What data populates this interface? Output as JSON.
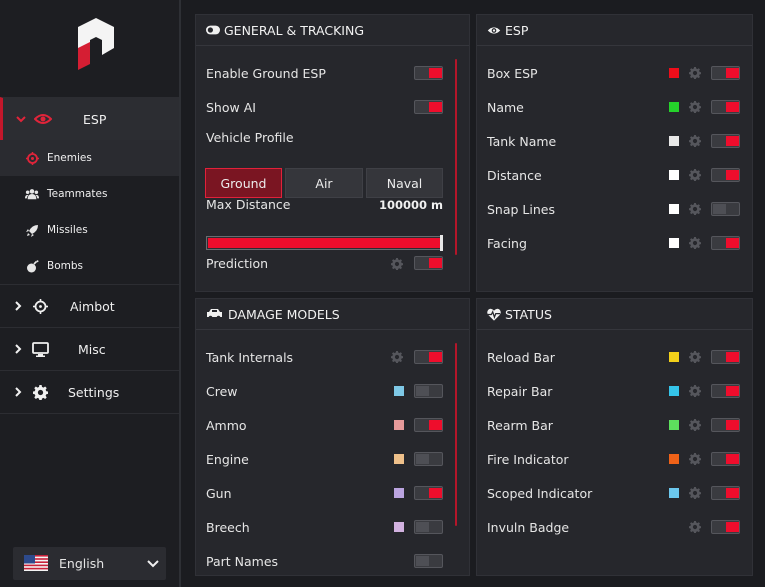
{
  "language": {
    "label": "English"
  },
  "sidebar": {
    "esp": {
      "label": "ESP",
      "subitems": [
        {
          "label": "Enemies"
        },
        {
          "label": "Teammates"
        },
        {
          "label": "Missiles"
        },
        {
          "label": "Bombs"
        }
      ]
    },
    "aimbot": {
      "label": "Aimbot"
    },
    "misc": {
      "label": "Misc"
    },
    "settings": {
      "label": "Settings"
    }
  },
  "general": {
    "title": "GENERAL & TRACKING",
    "enable_ground_esp": {
      "label": "Enable Ground ESP",
      "on": true
    },
    "show_ai": {
      "label": "Show AI",
      "on": true
    },
    "vehicle_profile": {
      "label": "Vehicle Profile",
      "options": [
        "Ground",
        "Air",
        "Naval"
      ],
      "selected": "Ground"
    },
    "max_distance": {
      "label": "Max Distance",
      "value_text": "100000 m",
      "fraction": 1.0
    },
    "prediction": {
      "label": "Prediction",
      "on": true
    }
  },
  "esp": {
    "title": "ESP",
    "rows": [
      {
        "label": "Box ESP",
        "color": "#ee0d1a",
        "on": true
      },
      {
        "label": "Name",
        "color": "#25d22b",
        "on": true
      },
      {
        "label": "Tank Name",
        "color": "#e8e8e8",
        "on": true
      },
      {
        "label": "Distance",
        "color": "#ffffff",
        "on": true
      },
      {
        "label": "Snap Lines",
        "color": "#ffffff",
        "on": false
      },
      {
        "label": "Facing",
        "color": "#ffffff",
        "on": true
      }
    ]
  },
  "damage": {
    "title": "DAMAGE MODELS",
    "rows": [
      {
        "label": "Tank Internals",
        "color": null,
        "gear": true,
        "on": true
      },
      {
        "label": "Crew",
        "color": "#7ec8e6",
        "gear": false,
        "on": false
      },
      {
        "label": "Ammo",
        "color": "#e69a9a",
        "gear": false,
        "on": true
      },
      {
        "label": "Engine",
        "color": "#eec08a",
        "gear": false,
        "on": false
      },
      {
        "label": "Gun",
        "color": "#bba4e0",
        "gear": false,
        "on": true
      },
      {
        "label": "Breech",
        "color": "#d2b2e0",
        "gear": false,
        "on": false
      },
      {
        "label": "Part Names",
        "color": null,
        "gear": false,
        "on": false
      }
    ]
  },
  "status": {
    "title": "STATUS",
    "rows": [
      {
        "label": "Reload Bar",
        "color": "#f2d01a",
        "on": true
      },
      {
        "label": "Repair Bar",
        "color": "#35c5ea",
        "on": true
      },
      {
        "label": "Rearm Bar",
        "color": "#5de05d",
        "on": true
      },
      {
        "label": "Fire Indicator",
        "color": "#ef6218",
        "on": true
      },
      {
        "label": "Scoped Indicator",
        "color": "#6cc8ee",
        "on": true
      },
      {
        "label": "Invuln Badge",
        "color": null,
        "on": true
      }
    ]
  },
  "colors": {
    "accent": "#ee0d2c",
    "background": "#1b1c20",
    "panel": "#26272c"
  }
}
